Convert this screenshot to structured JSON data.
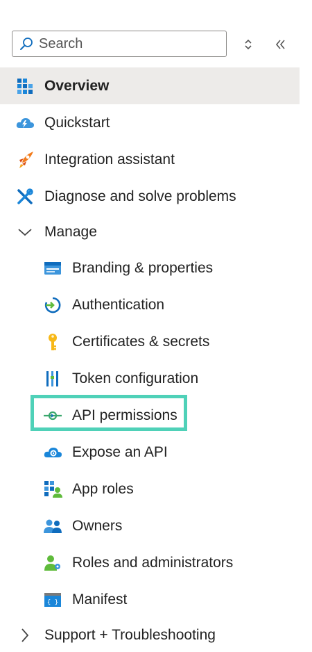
{
  "search": {
    "placeholder": "Search",
    "value": ""
  },
  "nav": {
    "overview": "Overview",
    "quickstart": "Quickstart",
    "integration_assistant": "Integration assistant",
    "diagnose": "Diagnose and solve problems",
    "manage": "Manage",
    "manage_items": {
      "branding": "Branding & properties",
      "authentication": "Authentication",
      "certificates": "Certificates & secrets",
      "token": "Token configuration",
      "api_permissions": "API permissions",
      "expose_api": "Expose an API",
      "app_roles": "App roles",
      "owners": "Owners",
      "roles_admins": "Roles and administrators",
      "manifest": "Manifest"
    },
    "support": "Support + Troubleshooting"
  },
  "colors": {
    "active_bg": "#edebe9",
    "highlight_border": "#4fd1b8"
  }
}
